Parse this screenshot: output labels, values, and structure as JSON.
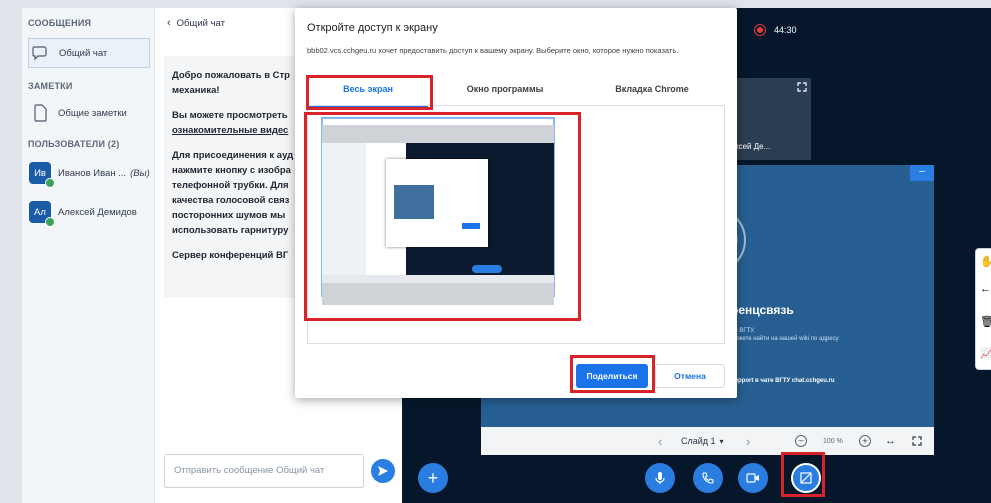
{
  "sidebar": {
    "messages_header": "СООБЩЕНИЯ",
    "public_chat_label": "Общий чат",
    "notes_header": "ЗАМЕТКИ",
    "shared_notes_label": "Общие заметки",
    "users_header": "ПОЛЬЗОВАТЕЛИ (2)",
    "users": [
      {
        "initials": "Ив",
        "name": "Иванов Иван ...",
        "suffix": "(Вы)"
      },
      {
        "initials": "Ал",
        "name": "Алексей Демидов",
        "suffix": ""
      }
    ]
  },
  "chat": {
    "back_title": "Общий чат",
    "welcome_lines": [
      "Добро пожаловать в Стр",
      "механика!",
      "Вы можете просмотреть",
      "ознакомительные видес",
      "Для присоединения к ауд",
      "нажмите кнопку с изобра",
      "телефонной трубки. Для",
      "качества голосовой связ",
      "посторонних шумов мы",
      "использовать гарнитуру",
      "Сервер конференций ВГ"
    ],
    "input_placeholder": "Отправить сообщение Общий чат"
  },
  "meeting": {
    "timer": "44:30",
    "thumb_name": "ксей Де...",
    "slide_title": "ренцсвязь",
    "slide_line1": "ер ВГТУ.",
    "slide_line2": "можете найти на нашей wiki по адресу",
    "slide_line3": "support в чате ВГТУ chat.cchgeu.ru",
    "slide_label": "Слайд 1",
    "zoom": "100 %",
    "minimize_label": "–"
  },
  "dialog": {
    "title": "Откройте доступ к экрану",
    "description": "bbb02.vcs.cchgeu.ru хочет предоставить доступ к вашему экрану. Выберите окно, которое нужно показать.",
    "tabs": [
      "Весь экран",
      "Окно программы",
      "Вкладка Chrome"
    ],
    "share_label": "Поделиться",
    "cancel_label": "Отмена"
  },
  "colors": {
    "accent": "#2a7de1",
    "chrome_blue": "#1a73e8",
    "highlight": "#d9232a",
    "stage_bg": "#06172b",
    "slide_bg": "#275f92"
  }
}
